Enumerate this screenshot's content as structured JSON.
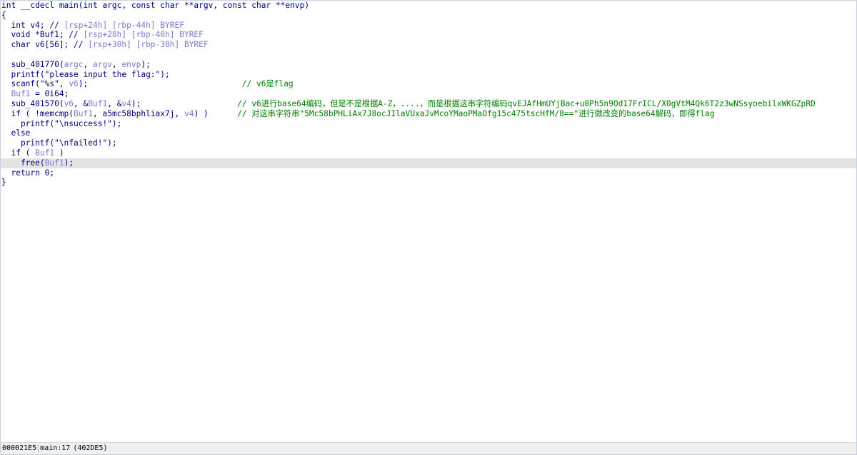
{
  "code": {
    "lines": [
      {
        "segments": [
          {
            "t": "int __cdecl main(int argc, const char **argv, const char **envp)",
            "c": "kw"
          }
        ]
      },
      {
        "segments": [
          {
            "t": "{",
            "c": "kw"
          }
        ]
      },
      {
        "segments": [
          {
            "t": "  int v4; // ",
            "c": "kw"
          },
          {
            "t": "[rsp+24h] [rbp-44h] BYREF",
            "c": "var"
          }
        ]
      },
      {
        "segments": [
          {
            "t": "  void *Buf1; // ",
            "c": "kw"
          },
          {
            "t": "[rsp+28h] [rbp-40h] BYREF",
            "c": "var"
          }
        ]
      },
      {
        "segments": [
          {
            "t": "  char v6[56]; // ",
            "c": "kw"
          },
          {
            "t": "[rsp+30h] [rbp-38h] BYREF",
            "c": "var"
          }
        ]
      },
      {
        "segments": [
          {
            "t": "",
            "c": "kw"
          }
        ]
      },
      {
        "segments": [
          {
            "t": "  sub_401770(",
            "c": "kw"
          },
          {
            "t": "argc",
            "c": "var"
          },
          {
            "t": ", ",
            "c": "kw"
          },
          {
            "t": "argv",
            "c": "var"
          },
          {
            "t": ", ",
            "c": "kw"
          },
          {
            "t": "envp",
            "c": "var"
          },
          {
            "t": ");",
            "c": "kw"
          }
        ]
      },
      {
        "segments": [
          {
            "t": "  printf(",
            "c": "kw"
          },
          {
            "t": "\"please input the flag:\"",
            "c": "kw"
          },
          {
            "t": ");",
            "c": "kw"
          }
        ]
      },
      {
        "segments": [
          {
            "t": "  scanf(\"%s\", ",
            "c": "kw"
          },
          {
            "t": "v6",
            "c": "var"
          },
          {
            "t": ");                                ",
            "c": "kw"
          },
          {
            "t": "// v6是flag",
            "c": "cmt"
          }
        ]
      },
      {
        "segments": [
          {
            "t": "  Buf1",
            "c": "var"
          },
          {
            "t": " = 0i64;",
            "c": "kw"
          }
        ]
      },
      {
        "segments": [
          {
            "t": "  sub_401570(",
            "c": "kw"
          },
          {
            "t": "v6",
            "c": "var"
          },
          {
            "t": ", &",
            "c": "kw"
          },
          {
            "t": "Buf1",
            "c": "var"
          },
          {
            "t": ", &",
            "c": "kw"
          },
          {
            "t": "v4",
            "c": "var"
          },
          {
            "t": ");                    ",
            "c": "kw"
          },
          {
            "t": "// v6进行base64编码，但是不是根据A-Z，....，而是根据这串字符编码qvEJAfHmUYjBac+u8Ph5n9Od17FrICL/X0gVtM4Qk6T2z3wNSsyoebilxWKGZpRD",
            "c": "cmt"
          }
        ]
      },
      {
        "segments": [
          {
            "t": "  if ( !memcmp(",
            "c": "kw"
          },
          {
            "t": "Buf1",
            "c": "var"
          },
          {
            "t": ", a5mc58bphliax7j, ",
            "c": "kw"
          },
          {
            "t": "v4",
            "c": "var"
          },
          {
            "t": ") )      ",
            "c": "kw"
          },
          {
            "t": "// 对这串字符串\"5Mc58bPHLiAx7J8ocJIlaVUxaJvMcoYMaoPMaOfg15c475tscHfM/8==\"进行微改变的base64解码，即得flag",
            "c": "cmt"
          }
        ]
      },
      {
        "segments": [
          {
            "t": "    printf(\"\\nsuccess!\");",
            "c": "kw"
          }
        ]
      },
      {
        "segments": [
          {
            "t": "  else",
            "c": "kw"
          }
        ]
      },
      {
        "segments": [
          {
            "t": "    printf(\"\\nfailed!\");",
            "c": "kw"
          }
        ]
      },
      {
        "segments": [
          {
            "t": "  if ( ",
            "c": "kw"
          },
          {
            "t": "Buf1",
            "c": "var"
          },
          {
            "t": " )",
            "c": "kw"
          }
        ]
      },
      {
        "segments": [
          {
            "t": "    free(",
            "c": "kw"
          },
          {
            "t": "Buf1",
            "c": "var"
          },
          {
            "t": ");",
            "c": "kw"
          }
        ],
        "highlight": true
      },
      {
        "segments": [
          {
            "t": "  return 0;",
            "c": "kw"
          }
        ]
      },
      {
        "segments": [
          {
            "t": "}",
            "c": "kw"
          }
        ]
      }
    ]
  },
  "status": {
    "address": "000021E5",
    "location": "main:17",
    "ea": "(402DE5)"
  },
  "colors": {
    "keyword": "#000080",
    "variable": "#7a7ad6",
    "comment": "#008000",
    "highlight_line": "#e4e4e4"
  }
}
